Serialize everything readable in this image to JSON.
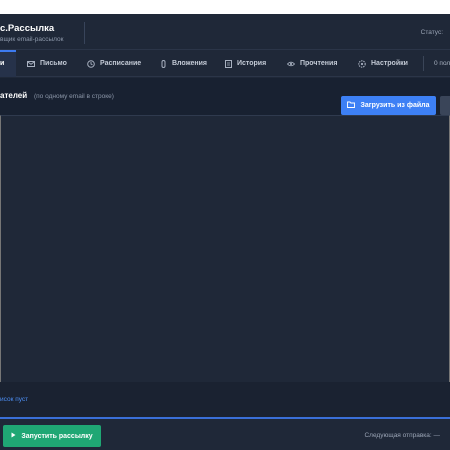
{
  "app": {
    "title": "с.Рассылка",
    "subtitle": "вщик email-рассылок",
    "status_label": "Статус:"
  },
  "tabs": [
    {
      "label": "и",
      "icon": "users-icon"
    },
    {
      "label": "Письмо",
      "icon": "mail-icon"
    },
    {
      "label": "Расписание",
      "icon": "clock-icon"
    },
    {
      "label": "Вложения",
      "icon": "paperclip-icon"
    },
    {
      "label": "История",
      "icon": "document-icon"
    },
    {
      "label": "Прочтения",
      "icon": "eye-icon"
    },
    {
      "label": "Настройки",
      "icon": "gear-icon"
    }
  ],
  "counter_label": "0 пол",
  "recipients": {
    "title": "ателей",
    "hint": "(по одному email в строке)",
    "upload_label": "Загрузить из файла",
    "upload_icon": "folder-icon",
    "list_value": "",
    "list_status": "исок пуст"
  },
  "footer": {
    "start_label": "Запустить рассылку",
    "start_icon": "play-icon",
    "next_send": "Следующая отправка: —"
  },
  "colors": {
    "accent": "#3d80f5",
    "success": "#1fa774",
    "background": "#1f2838"
  }
}
